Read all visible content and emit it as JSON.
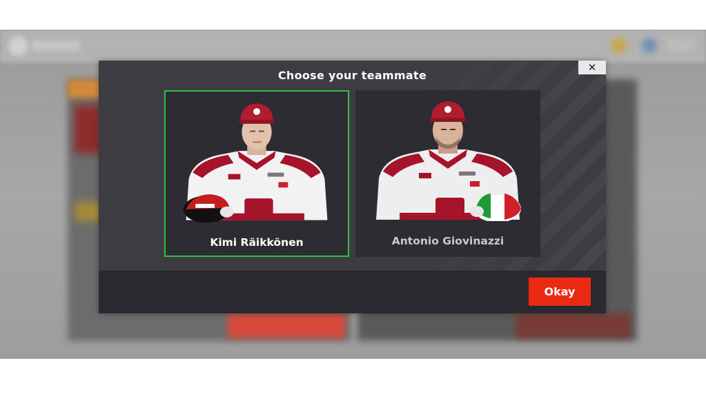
{
  "dialog": {
    "title": "Choose your teammate",
    "close_label": "✕",
    "ok_label": "Okay"
  },
  "drivers": [
    {
      "name": "Kimi Räikkönen",
      "selected": true,
      "helmet_colors": [
        "#c21e1e",
        "#111111",
        "#ffffff"
      ]
    },
    {
      "name": "Antonio Giovinazzi",
      "selected": false,
      "helmet_colors": [
        "#1f9a3a",
        "#ffffff",
        "#d0202a"
      ]
    }
  ],
  "colors": {
    "accent_selected": "#2fc23f",
    "ok_button": "#ea2a12",
    "suit_red": "#a5142a",
    "suit_white": "#f2f2f2"
  }
}
